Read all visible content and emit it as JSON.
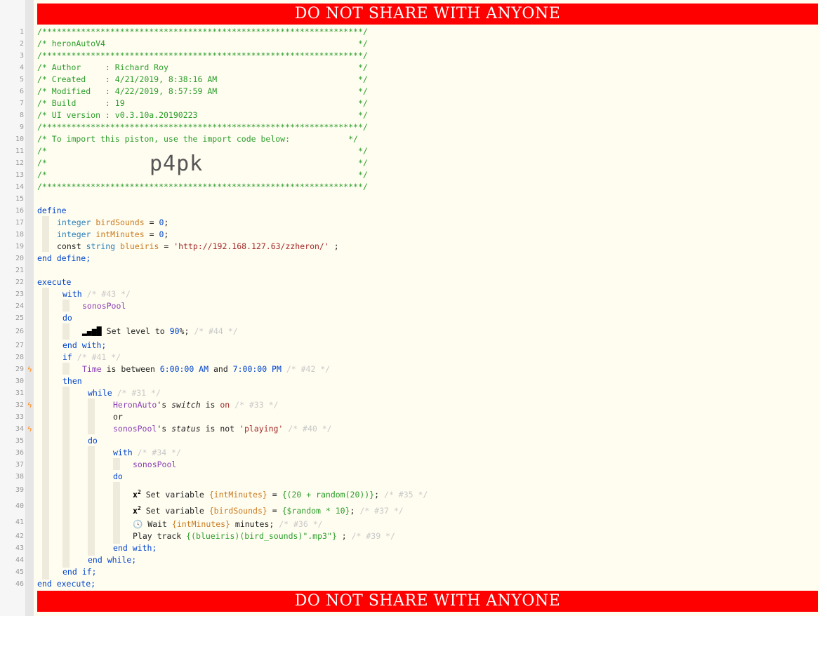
{
  "banner": {
    "top": "DO NOT SHARE WITH ANYONE",
    "bottom": "DO NOT SHARE WITH ANYONE"
  },
  "import_code": "p4pk",
  "line_numbers": [
    "1",
    "2",
    "3",
    "4",
    "5",
    "6",
    "7",
    "8",
    "9",
    "10",
    "11",
    "12",
    "13",
    "14",
    "15",
    "16",
    "17",
    "18",
    "19",
    "20",
    "21",
    "22",
    "23",
    "24",
    "25",
    "26",
    "27",
    "28",
    "29",
    "30",
    "31",
    "32",
    "33",
    "34",
    "35",
    "36",
    "37",
    "38",
    "39",
    "40",
    "41",
    "42",
    "43",
    "44",
    "45",
    "46"
  ],
  "header": {
    "stars": "/******************************************************************/",
    "name": "/* heronAutoV4                                                    */",
    "author": "/* Author     : Richard Roy                                       */",
    "created": "/* Created    : 4/21/2019, 8:38:16 AM                             */",
    "modified": "/* Modified   : 4/22/2019, 8:57:59 AM                             */",
    "build": "/* Build      : 19                                                */",
    "ui_version": "/* UI version : v0.3.10a.20190223                                 */",
    "import_hint": "/* To import this piston, use the import code below:            */",
    "blank": "/*                                                                */"
  },
  "code": {
    "define": "define",
    "integer": "integer",
    "birdSounds": "birdSounds",
    "intMinutes": "intMinutes",
    "eq_zero": " = ",
    "zero": "0",
    "semi": ";",
    "const": "const",
    "string": "string",
    "blueiris": "blueiris",
    "url": "'http://192.168.127.63/zzheron/'",
    "end_define": "end define;",
    "execute": "execute",
    "with": "with",
    "c43": "/* #43 */",
    "sonosPool": "sonosPool",
    "do": "do",
    "set_level": "Set level to ",
    "level_value": "90",
    "pct_semi": "%;",
    "c44": "/* #44 */",
    "end_with": "end with;",
    "if": "if",
    "c41": "/* #41 */",
    "time": "Time",
    "is_between": " is between ",
    "t_start": "6:00:00 AM",
    "and": " and ",
    "t_end": "7:00:00 PM",
    "c42": "/* #42 */",
    "then": "then",
    "while": "while",
    "c31": "/* #31 */",
    "heronAuto": "HeronAuto",
    "apos_s": "'s ",
    "switch": "switch",
    "is": " is ",
    "on": "on",
    "c33": "/* #33 */",
    "or": "or",
    "status": "status",
    "is_not": " is not ",
    "playing": "'playing'",
    "c40": "/* #40 */",
    "c34": "/* #34 */",
    "set_variable": "Set variable ",
    "v_intMinutes": "{intMinutes}",
    "assign": " = ",
    "expr1": "{(20 + random(20))}",
    "c35": "/* #35 */",
    "v_birdSounds": "{birdSounds}",
    "expr2": "{$random * 10}",
    "c37": "/* #37 */",
    "wait": "Wait ",
    "minutes": " minutes;",
    "c36": "/* #36 */",
    "play_track": "Play track ",
    "expr3": "{(blueiris)(bird_sounds)\".mp3\"}",
    "semi_sp": " ;",
    "c39": "/* #39 */",
    "end_with2": "end with;",
    "end_while": "end while;",
    "end_if": "end if;",
    "end_execute": "end execute;"
  },
  "icons": {
    "signal": "signal-bars-icon",
    "x2": "x-squared-icon",
    "clock": "clock-icon",
    "bolt": "lightning-bolt-icon"
  },
  "colors": {
    "banner": "#ff0000",
    "comment": "#2a9d2a",
    "keyword": "#0044cc",
    "variable": "#c97a1f",
    "device": "#8a3fb5",
    "string": "#a52a2a"
  }
}
